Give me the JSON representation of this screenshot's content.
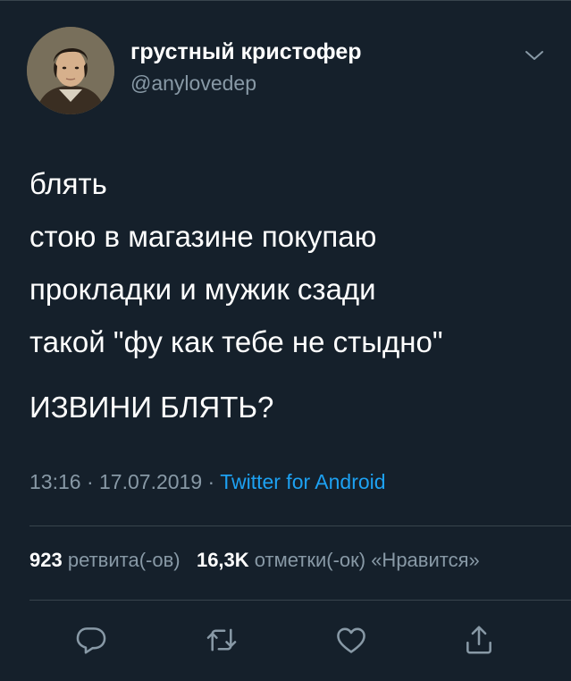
{
  "author": {
    "display_name": "грустный кристофер",
    "handle": "@anylovedep",
    "avatar_icon": "avatar"
  },
  "tweet": {
    "lines": [
      "блять",
      "стою в магазине покупаю",
      "прокладки и мужик сзади",
      "такой \"фу как тебе не стыдно\""
    ],
    "last_line": "ИЗВИНИ БЛЯТЬ?"
  },
  "meta": {
    "time": "13:16",
    "separator": "·",
    "date": "17.07.2019",
    "source": "Twitter for Android"
  },
  "stats": {
    "retweets_count": "923",
    "retweets_label": "ретвита(-ов)",
    "likes_count": "16,3K",
    "likes_label": "отметки(-ок) «Нравится»"
  },
  "actions": {
    "icons": [
      "reply-icon",
      "retweet-icon",
      "like-icon",
      "share-icon"
    ]
  },
  "colors": {
    "background": "#15202b",
    "text": "#ffffff",
    "secondary": "#8899a6",
    "accent": "#1da1f2",
    "divider": "#38444d"
  }
}
